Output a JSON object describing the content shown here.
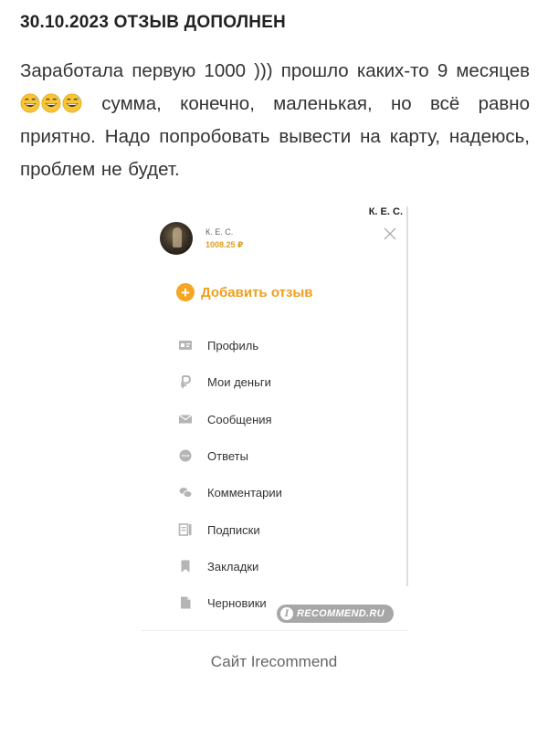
{
  "post": {
    "date_title": "30.10.2023 ОТЗЫВ ДОПОЛНЕН",
    "text_part1": "Заработала первую 1000 ))) прошло каких-то 9 месяцев",
    "text_part2": "сумма, конечно, маленькая, но всё равно приятно. Надо попробовать вывести на карту, надеюсь, проблем не будет.",
    "emoji_icons": [
      "grinning-sweat-face-icon",
      "grinning-sweat-face-icon",
      "grinning-sweat-face-icon"
    ]
  },
  "screenshot": {
    "corner_name": "К. Е. С.",
    "user": {
      "name": "К. Е. С.",
      "balance": "1008.25 ₽"
    },
    "add_review_label": "Добавить отзыв",
    "menu": [
      {
        "label": "Профиль",
        "icon": "profile-card-icon"
      },
      {
        "label": "Мои деньги",
        "icon": "ruble-icon"
      },
      {
        "label": "Сообщения",
        "icon": "envelope-icon"
      },
      {
        "label": "Ответы",
        "icon": "chat-bubble-icon"
      },
      {
        "label": "Комментарии",
        "icon": "comments-icon"
      },
      {
        "label": "Подписки",
        "icon": "subscriptions-icon"
      },
      {
        "label": "Закладки",
        "icon": "bookmark-icon"
      },
      {
        "label": "Черновики",
        "icon": "draft-document-icon"
      }
    ],
    "watermark": "RECOMMEND.RU",
    "watermark_badge": "I"
  },
  "caption": "Сайт Irecommend",
  "colors": {
    "accent": "#f5a623",
    "accent_text": "#f09d1b",
    "icon_gray": "#b5b5b5"
  }
}
